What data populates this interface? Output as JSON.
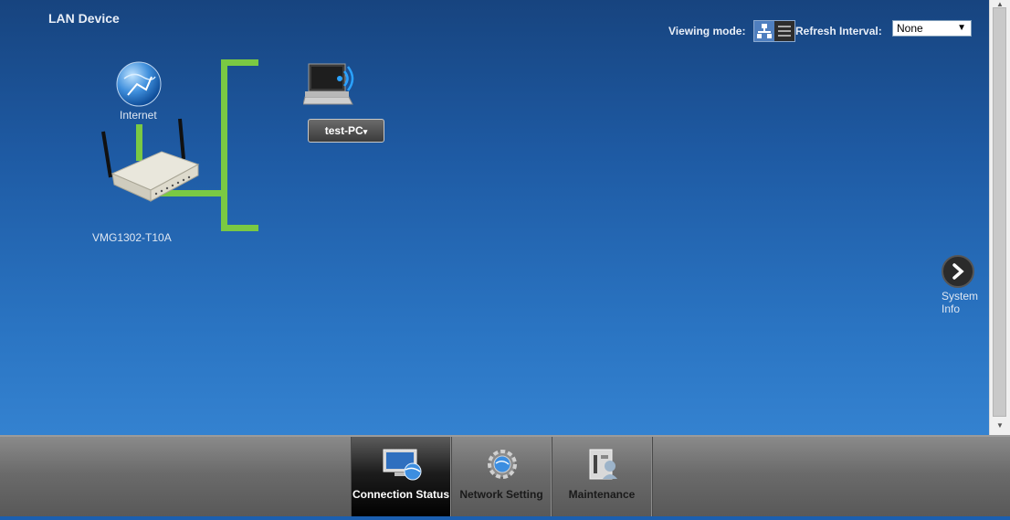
{
  "page": {
    "title": "LAN Device"
  },
  "toolbar": {
    "viewing_mode_label": "Viewing mode:",
    "refresh_interval_label": "Refresh Interval:",
    "refresh_interval_value": "None"
  },
  "topology": {
    "internet_label": "Internet",
    "router_label": "VMG1302-T10A",
    "device_button_label": "test-PC",
    "device_button_suffix": "▾"
  },
  "system_info": {
    "label_line1": "System",
    "label_line2": "Info"
  },
  "nav": {
    "tabs": [
      {
        "label": "Connection Status",
        "icon": "monitor-globe-icon",
        "active": true
      },
      {
        "label": "Network Setting",
        "icon": "gear-globe-icon",
        "active": false
      },
      {
        "label": "Maintenance",
        "icon": "maintenance-icon",
        "active": false
      }
    ]
  },
  "colors": {
    "topology_line": "#7ac943",
    "background_top": "#17447f",
    "background_bottom": "#3482d0",
    "active_tab": "#000000"
  }
}
